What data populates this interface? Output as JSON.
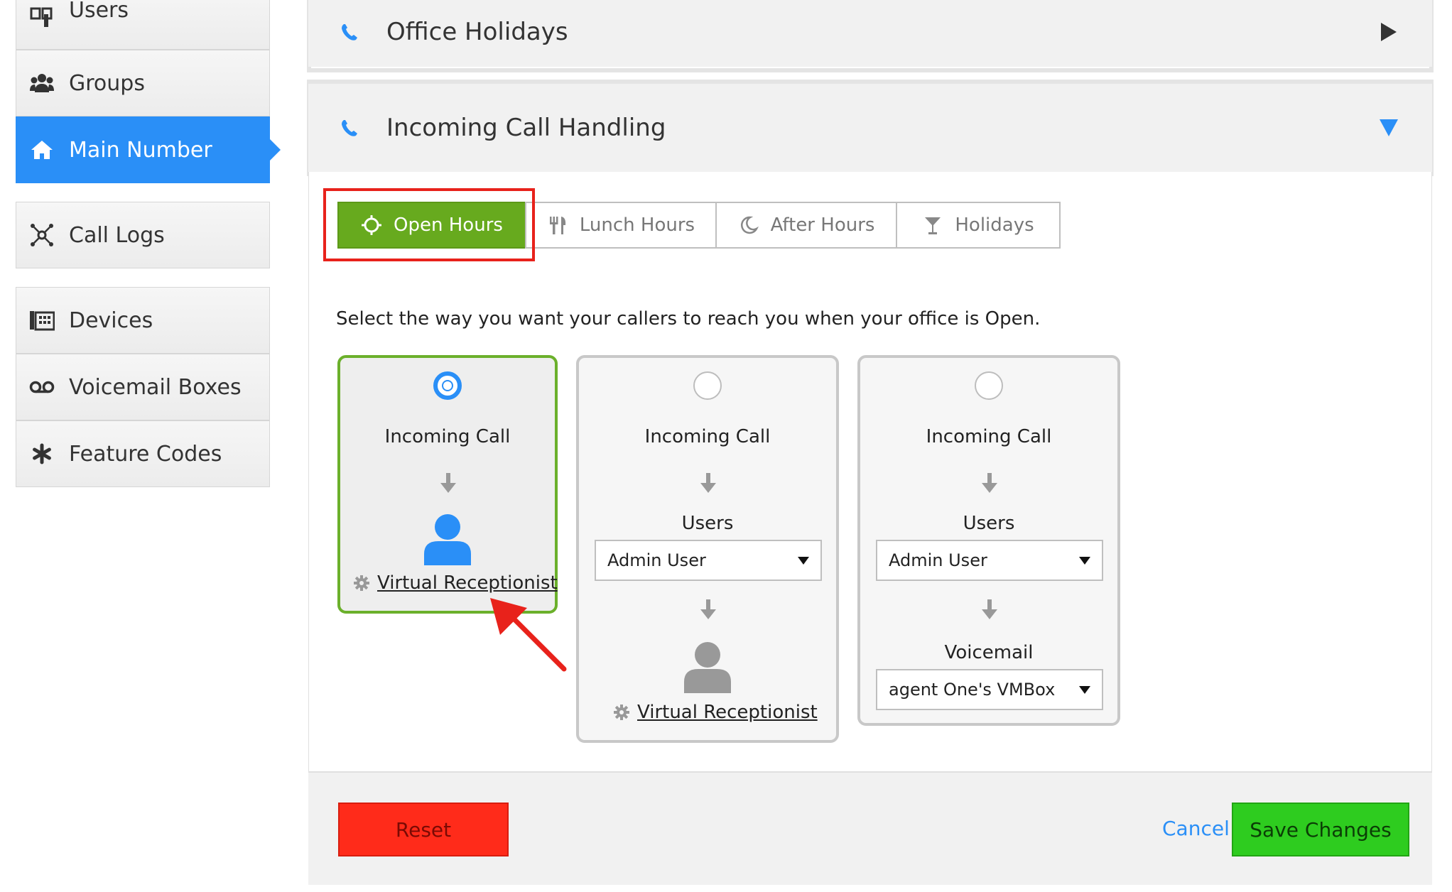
{
  "sidebar": {
    "items": [
      {
        "label": "Users",
        "icon": "users-icon"
      },
      {
        "label": "Groups",
        "icon": "groups-icon"
      },
      {
        "label": "Main Number",
        "icon": "home-icon"
      },
      {
        "label": "Call Logs",
        "icon": "call-logs-icon"
      },
      {
        "label": "Devices",
        "icon": "devices-icon"
      },
      {
        "label": "Voicemail Boxes",
        "icon": "voicemail-icon"
      },
      {
        "label": "Feature Codes",
        "icon": "asterisk-icon"
      }
    ],
    "active_color": "#2a8ff7"
  },
  "panels": {
    "office_holidays": {
      "title": "Office Holidays"
    },
    "incoming_call_handling": {
      "title": "Incoming Call Handling"
    }
  },
  "tabs": [
    {
      "label": "Open Hours",
      "icon": "sun-icon"
    },
    {
      "label": "Lunch Hours",
      "icon": "fork-knife-icon"
    },
    {
      "label": "After Hours",
      "icon": "moon-icon"
    },
    {
      "label": "Holidays",
      "icon": "cocktail-icon"
    }
  ],
  "active_tab_color": "#67aa1e",
  "instruction": "Select the way you want your callers to reach you when your office is Open.",
  "options": [
    {
      "selected": true,
      "incoming_label": "Incoming Call",
      "receptionist_label": "Virtual Receptionist"
    },
    {
      "selected": false,
      "incoming_label": "Incoming Call",
      "users_label": "Users",
      "users_value": "Admin User",
      "receptionist_label": "Virtual Receptionist"
    },
    {
      "selected": false,
      "incoming_label": "Incoming Call",
      "users_label": "Users",
      "users_value": "Admin User",
      "voicemail_label": "Voicemail",
      "voicemail_value": "agent One's VMBox"
    }
  ],
  "footer": {
    "reset_label": "Reset",
    "cancel_label": "Cancel",
    "save_label": "Save Changes"
  },
  "colors": {
    "accent_blue": "#2a8ff7",
    "selected_green": "#6bb02b",
    "reset_red": "#ff2b1a",
    "save_green": "#2ecc1f",
    "annotation_red": "#e8221b"
  }
}
